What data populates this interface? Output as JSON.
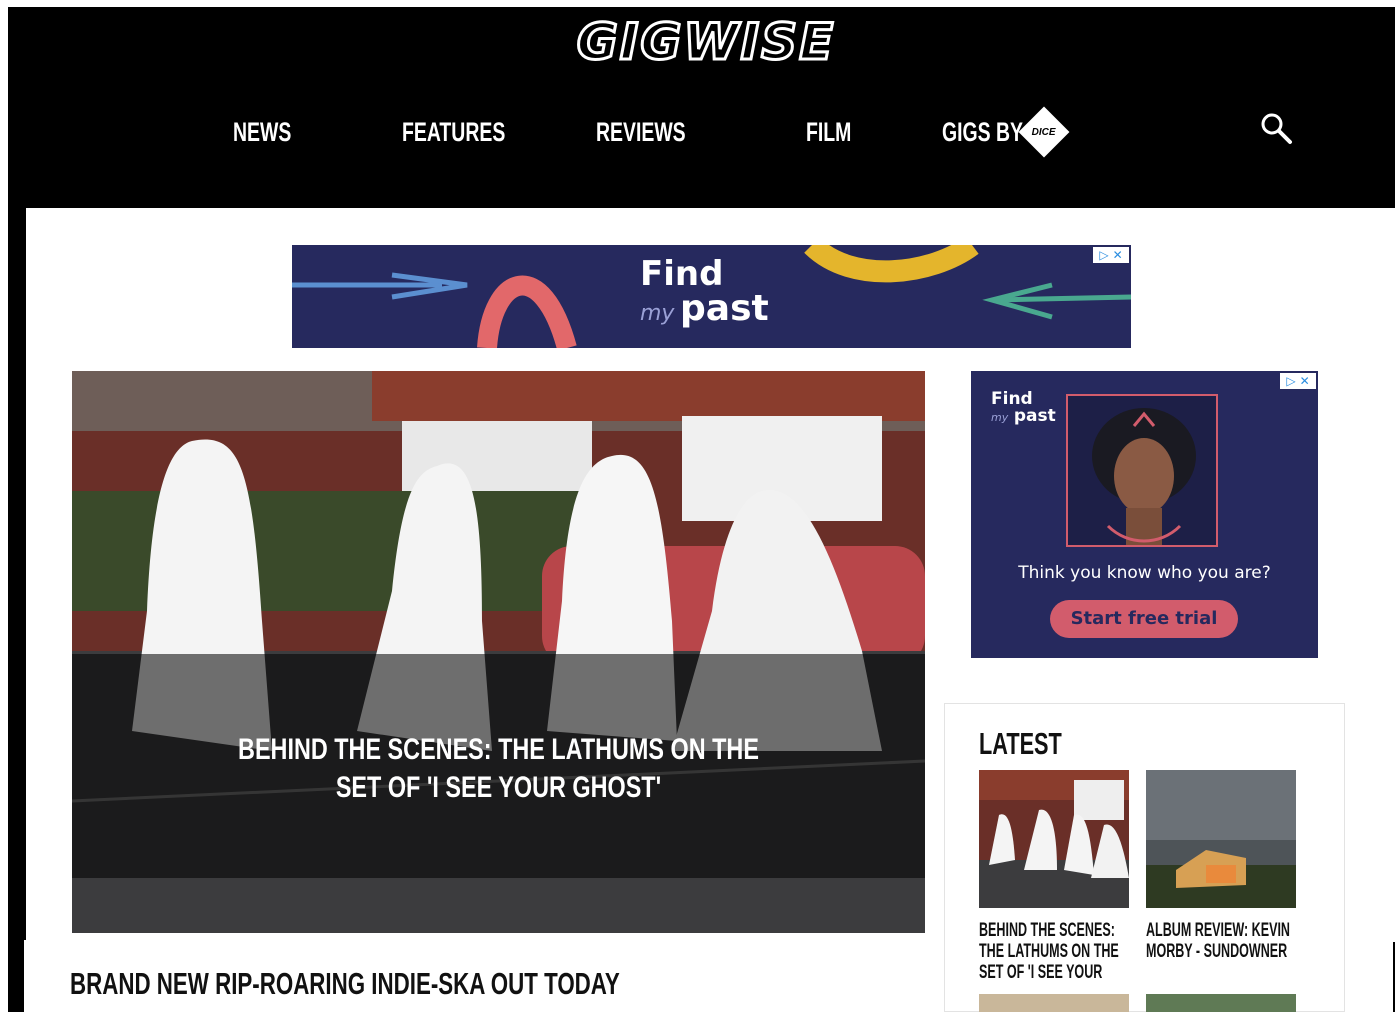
{
  "header": {
    "logo": "GIGWISE",
    "nav": [
      "NEWS",
      "FEATURES",
      "REVIEWS",
      "FILM"
    ],
    "gigs_by_label": "GIGS BY",
    "gigs_partner_logo": "DICE",
    "search_icon": "search-icon"
  },
  "banner_ad": {
    "brand_find": "Find",
    "brand_my": "my",
    "brand_past": "past",
    "adchoice_icon": "adchoices-icon"
  },
  "hero": {
    "title": "BEHIND THE SCENES: THE LATHUMS ON THE SET OF 'I SEE YOUR GHOST'"
  },
  "side_ad": {
    "brand_find": "Find",
    "brand_my": "my",
    "brand_past": "past",
    "tagline": "Think you know who you are?",
    "cta": "Start free trial"
  },
  "latest": {
    "heading": "LATEST",
    "items": [
      {
        "title": "BEHIND THE SCENES: THE LATHUMS ON THE SET OF 'I SEE YOUR"
      },
      {
        "title": "ALBUM REVIEW: KEVIN MORBY - SUNDOWNER"
      }
    ]
  },
  "lead_headline": "BRAND NEW RIP-ROARING INDIE-SKA OUT TODAY",
  "colors": {
    "header_bg": "#000000",
    "ad_bg": "#26295e",
    "ad_accent": "#d25c6c"
  }
}
